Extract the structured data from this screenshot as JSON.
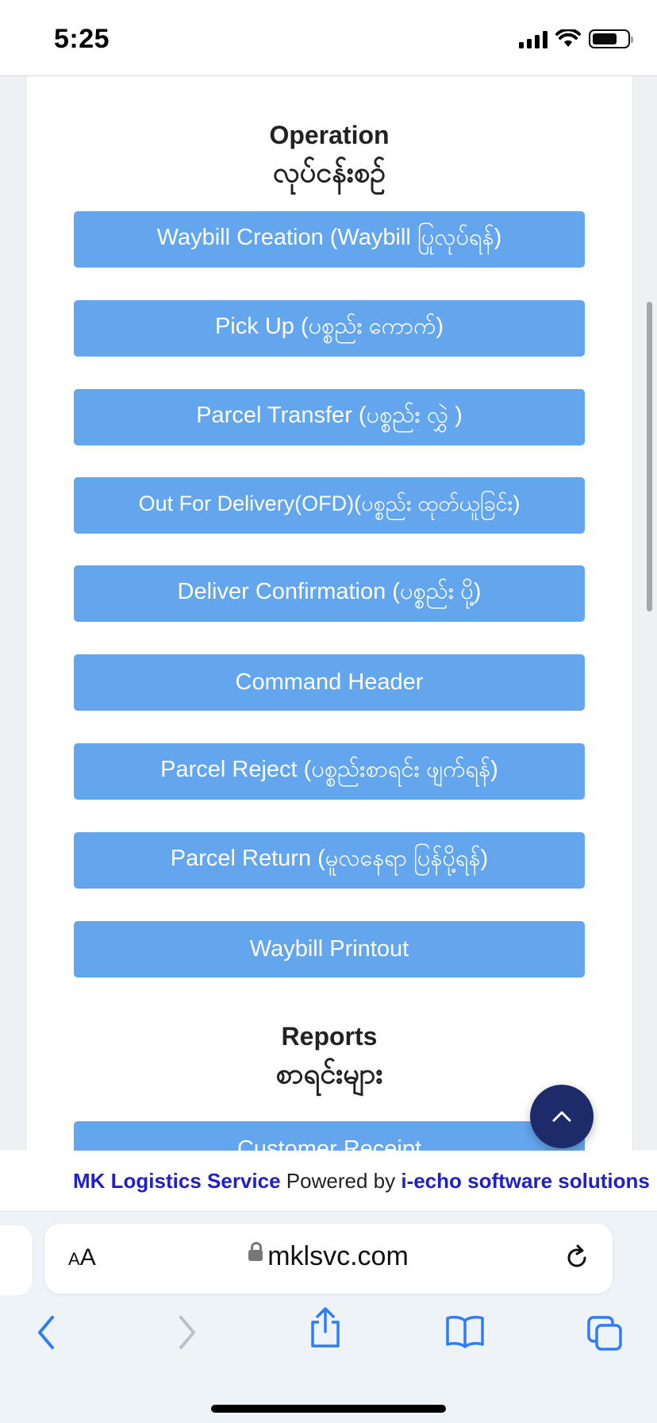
{
  "status_bar": {
    "time": "5:25"
  },
  "sections": {
    "operation": {
      "title": "Operation",
      "subtitle": "လုပ်ငန်းစဉ်"
    },
    "reports": {
      "title": "Reports",
      "subtitle": "စာရင်းများ"
    }
  },
  "operation_buttons": [
    "Waybill Creation (Waybill ပြုလုပ်ရန်)",
    "Pick Up (ပစ္စည်း ကောက်)",
    "Parcel Transfer (ပစ္စည်း လွှဲ )",
    "Out For Delivery(OFD)(ပစ္စည်း ထုတ်ယူခြင်း)",
    "Deliver Confirmation (ပစ္စည်း ပို့)",
    "Command Header",
    "Parcel Reject (ပစ္စည်းစာရင်း ဖျက်ရန်)",
    "Parcel Return (မူလနေရာ ပြန်ပို့ရန်)",
    "Waybill Printout"
  ],
  "report_buttons": [
    "Customer Receipt"
  ],
  "footer": {
    "brand": "MK Logistics Service",
    "powered_by": "Powered by",
    "vendor": "i-echo software solutions"
  },
  "browser": {
    "text_size_label_small": "A",
    "text_size_label_large": "A",
    "url": "mklsvc.com"
  },
  "colors": {
    "button": "#63a6ee",
    "fab": "#1e2b6b",
    "link": "#1f1fcf",
    "toolbar_icon": "#2f7cf6"
  }
}
